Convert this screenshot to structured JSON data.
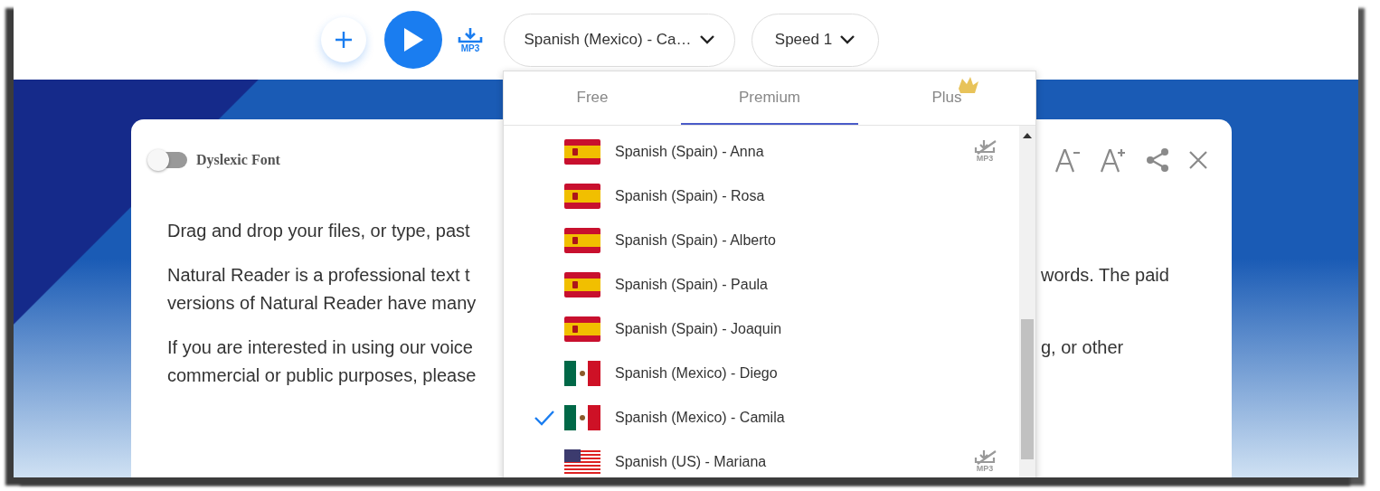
{
  "toolbar": {
    "download_label": "MP3",
    "voice_select": {
      "value": "Spanish (Mexico) - Ca…"
    },
    "speed_select": {
      "value": "Speed 1"
    }
  },
  "editor": {
    "dyslexic_toggle": {
      "label": "Dyslexic Font",
      "on": false
    },
    "lines": [
      {
        "left": "Drag and drop your files, or type, past"
      },
      {
        "left": "Natural Reader is a professional text t",
        "right": "words. The paid"
      },
      {
        "left": "versions of Natural Reader have many"
      },
      {
        "left": "If you are interested in using our voice",
        "right": "g, or other"
      },
      {
        "left": "commercial or public purposes, please"
      }
    ]
  },
  "voice_menu": {
    "tabs": [
      {
        "label": "Free",
        "selected": false
      },
      {
        "label": "Premium",
        "selected": true
      },
      {
        "label": "Plus",
        "selected": false,
        "crown": true
      }
    ],
    "voices": [
      {
        "name": "Spanish (Spain) - Anna",
        "kind": "spain",
        "selected": false,
        "mp3_off_label": "MP3"
      },
      {
        "name": "Spanish (Spain) - Rosa",
        "kind": "spain",
        "selected": false
      },
      {
        "name": "Spanish (Spain) - Alberto",
        "kind": "spain",
        "selected": false
      },
      {
        "name": "Spanish (Spain) - Paula",
        "kind": "spain",
        "selected": false
      },
      {
        "name": "Spanish (Spain) - Joaquin",
        "kind": "spain",
        "selected": false
      },
      {
        "name": "Spanish (Mexico) - Diego",
        "kind": "mexico",
        "selected": false
      },
      {
        "name": "Spanish (Mexico) - Camila",
        "kind": "mexico",
        "selected": true
      },
      {
        "name": "Spanish (US) - Mariana",
        "kind": "us",
        "selected": false,
        "mp3_off_label": "MP3"
      }
    ]
  }
}
